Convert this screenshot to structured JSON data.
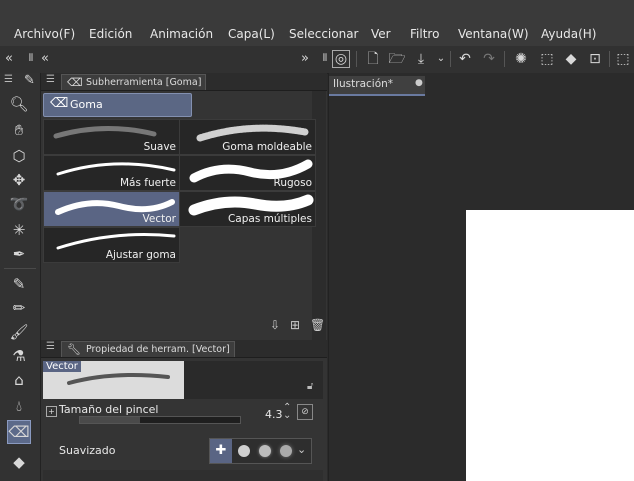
{
  "menu": [
    "Archivo(F)",
    "Edición",
    "Animación",
    "Capa(L)",
    "Seleccionar",
    "Ver",
    "Filtro",
    "Ventana(W)",
    "Ayuda(H)"
  ],
  "subtool_panel": {
    "tab_label": "Subherramienta [Goma]",
    "group_label": "Goma",
    "brushes": [
      "Suave",
      "Goma moldeable",
      "Más fuerte",
      "Rugoso",
      "Vector",
      "Capas múltiples",
      "Ajustar goma"
    ],
    "selected_brush": "Vector"
  },
  "property_panel": {
    "tab_label": "Propiedad de herram. [Vector]",
    "preview_label": "Vector",
    "brush_size_label": "Tamaño del pincel",
    "brush_size_value": "4.3",
    "smoothing_label": "Suavizado"
  },
  "document": {
    "tab_label": "Ilustración*"
  },
  "colors": {
    "accent": "#5b6784",
    "paper": "#ffffff"
  }
}
